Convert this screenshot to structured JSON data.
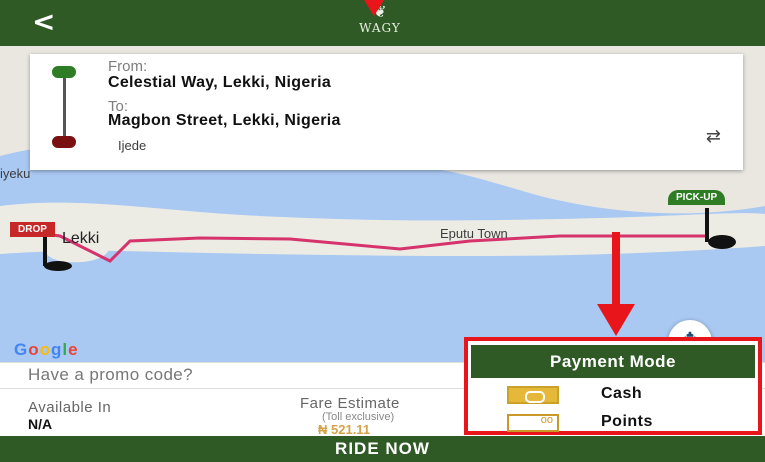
{
  "header": {
    "back_label": "<",
    "logo_text": "WAGY"
  },
  "route": {
    "from_label": "From:",
    "from_address": "Celestial Way, Lekki, Nigeria",
    "to_label": "To:",
    "to_address": "Magbon Street, Lekki, Nigeria"
  },
  "map": {
    "places": {
      "ijede": "Ijede",
      "iyeku": "iyeku",
      "lekki": "Lekki",
      "eputu": "Eputu Town"
    },
    "drop_flag": "DROP",
    "pickup_flag": "PICK-UP",
    "google": [
      "G",
      "o",
      "o",
      "g",
      "l",
      "e"
    ],
    "google_colors": [
      "#4285f4",
      "#ea4335",
      "#fbbc05",
      "#4285f4",
      "#34a853",
      "#ea4335"
    ]
  },
  "promo": {
    "placeholder": "Have a promo code?"
  },
  "info": {
    "available_label": "Available In",
    "available_value": "N/A",
    "fare_label": "Fare Estimate",
    "fare_sub": "(Toll exclusive)",
    "fare_value": "₦ 521.11"
  },
  "payment": {
    "title": "Payment Mode",
    "options": [
      "Cash",
      "Points"
    ]
  },
  "ride_button": "RIDE NOW",
  "colors": {
    "brand_green": "#2f5a25",
    "annotation_red": "#e8161a",
    "route_pink": "#d6336c"
  }
}
